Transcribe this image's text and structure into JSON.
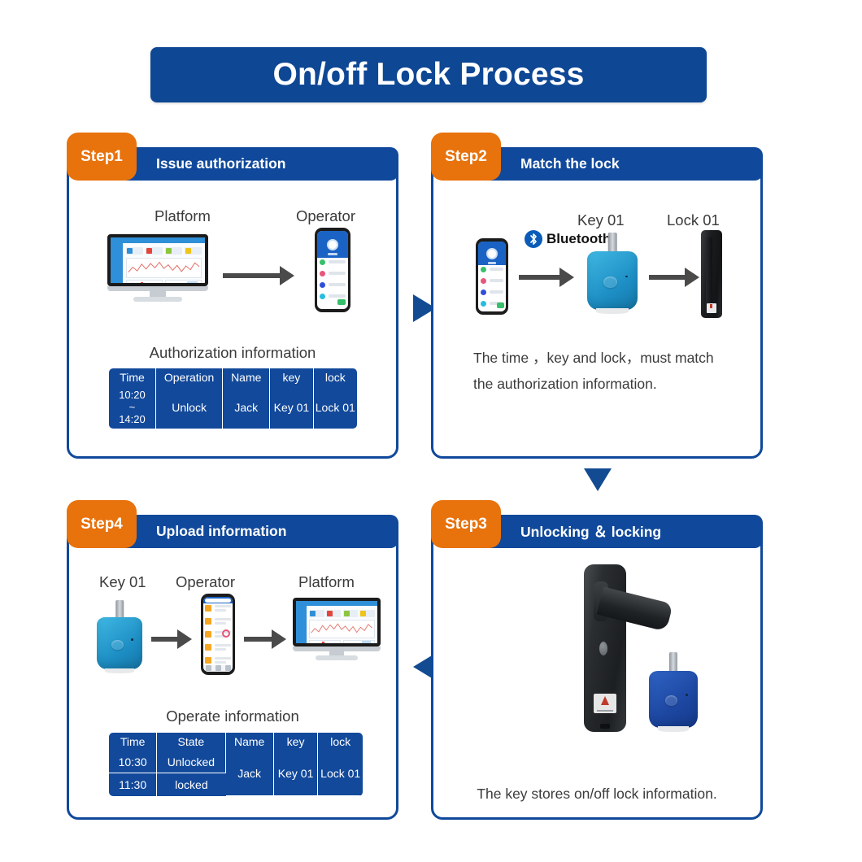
{
  "title": "On/off Lock Process",
  "theme": {
    "blue": "#10499B",
    "orange": "#E8720C",
    "table_blue": "#12499B",
    "arrow_grey": "#4a4a4a",
    "key_blue": "#1d8ec4"
  },
  "steps": [
    {
      "badge": "Step1",
      "header": "Issue authorization",
      "captions": {
        "left": "Platform",
        "right": "Operator"
      },
      "table_title": "Authorization information",
      "table": {
        "headers": [
          "Time",
          "Operation",
          "Name",
          "key",
          "lock"
        ],
        "rows": [
          {
            "time": "10:20\n~\n14:20",
            "operation": "Unlock",
            "name": "Jack",
            "key": "Key 01",
            "lock": "Lock 01"
          }
        ]
      }
    },
    {
      "badge": "Step2",
      "header": "Match the lock",
      "captions": {
        "key": "Key 01",
        "lock": "Lock 01"
      },
      "bluetooth_label": "Bluetooth",
      "body_lines": [
        "The time ，key and lock，must match",
        "the authorization information."
      ]
    },
    {
      "badge": "Step3",
      "header": "Unlocking ＆ locking",
      "body_lines": [
        "The key stores on/off lock information."
      ]
    },
    {
      "badge": "Step4",
      "header": "Upload information",
      "captions": {
        "left": "Key 01",
        "middle": "Operator",
        "right": "Platform"
      },
      "table_title": "Operate information",
      "table": {
        "headers": [
          "Time",
          "State",
          "Name",
          "key",
          "lock"
        ],
        "rows": [
          {
            "time": "10:30",
            "state": "Unlocked"
          },
          {
            "time": "11:30",
            "state": "locked"
          }
        ],
        "merged": {
          "name": "Jack",
          "key": "Key 01",
          "lock": "Lock 01"
        }
      }
    }
  ],
  "connectors": [
    {
      "name": "step1-to-step2",
      "direction": "right"
    },
    {
      "name": "step2-to-step3",
      "direction": "down"
    },
    {
      "name": "step3-to-step4",
      "direction": "left"
    }
  ]
}
